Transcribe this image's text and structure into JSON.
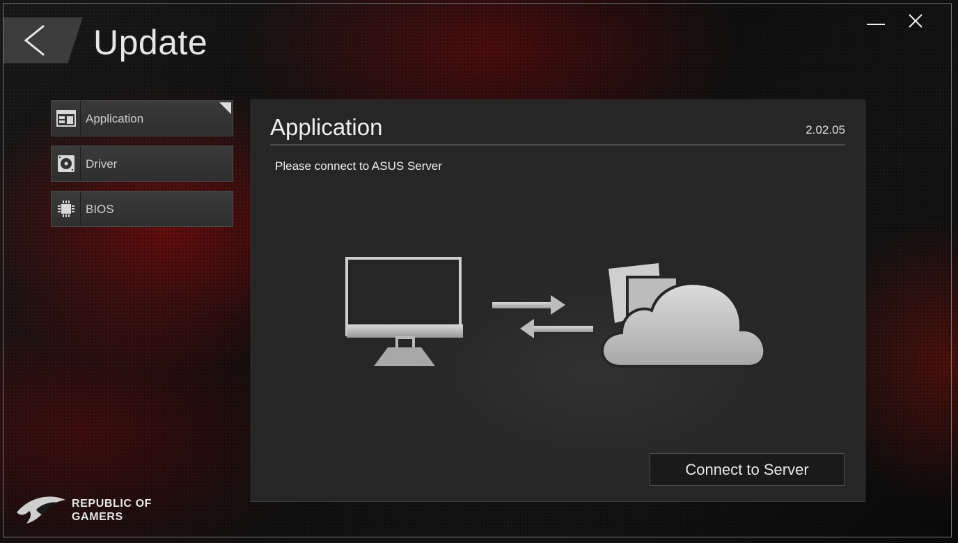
{
  "window": {
    "title": "Update",
    "controls": [
      "minimize-icon",
      "close-icon"
    ]
  },
  "sidebar": {
    "items": [
      {
        "label": "Application",
        "icon": "application-window-icon",
        "selected": true
      },
      {
        "label": "Driver",
        "icon": "disc-drive-icon",
        "selected": false
      },
      {
        "label": "BIOS",
        "icon": "chip-icon",
        "selected": false
      }
    ]
  },
  "panel": {
    "title": "Application",
    "version": "2.02.05",
    "message": "Please connect to ASUS Server",
    "illustration_icons": [
      "monitor-icon",
      "transfer-arrows-icon",
      "cloud-files-icon"
    ],
    "connect_label": "Connect to Server"
  },
  "brand": {
    "line1": "REPUBLIC OF",
    "line2": "GAMERS",
    "logo_icon": "rog-eye-logo"
  },
  "colors": {
    "accent_red": "#b01010",
    "panel_bg": "#262626",
    "text": "#e8e8e8"
  }
}
